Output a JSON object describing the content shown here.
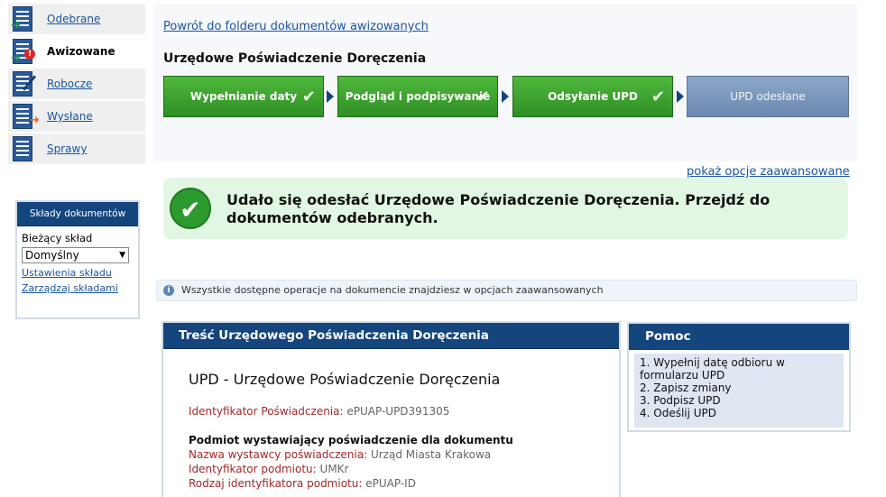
{
  "nav": {
    "items": [
      {
        "label": "Odebrane"
      },
      {
        "label": "Awizowane"
      },
      {
        "label": "Robocze"
      },
      {
        "label": "Wysłane"
      },
      {
        "label": "Sprawy"
      }
    ]
  },
  "sklady": {
    "title": "Składy dokumentów",
    "current_label": "Bieżący skład",
    "selected": "Domyślny",
    "settings_link": "Ustawienia składu",
    "manage_link": "Zarządzaj składami"
  },
  "main": {
    "back_link": "Powrót do folderu dokumentów awizowanych",
    "title": "Urzędowe Poświadczenie Doręczenia",
    "steps": [
      {
        "label": "Wypełnianie daty"
      },
      {
        "label": "Podgląd i podpisywanie"
      },
      {
        "label": "Odsyłanie UPD"
      },
      {
        "label": "UPD odesłane"
      }
    ],
    "advanced_link": "pokaż opcje zaawansowane",
    "success_message": "Udało się odesłać Urzędowe Poświadczenie Doręczenia. Przejdź do dokumentów odebranych.",
    "info_text": "Wszystkie dostępne operacje na dokumencie znajdziesz w opcjach zaawansowanych"
  },
  "panel": {
    "header": "Treść Urzędowego Poświadczenia Doręczenia",
    "doc_title": "UPD - Urzędowe Poświadczenie Doręczenia",
    "id_label": "Identyfikator Poświadczenia:",
    "id_value": "ePUAP-UPD391305",
    "section_title": "Podmiot wystawiający poświadczenie dla dokumentu",
    "fields": [
      {
        "label": "Nazwa wystawcy poświadczenia:",
        "value": "Urząd Miasta Krakowa"
      },
      {
        "label": "Identyfikator podmiotu:",
        "value": "UMKr"
      },
      {
        "label": "Rodzaj identyfikatora podmiotu:",
        "value": "ePUAP-ID"
      }
    ]
  },
  "help": {
    "header": "Pomoc",
    "steps": [
      "1. Wypełnij datę odbioru w formularzu UPD",
      "2. Zapisz zmiany",
      "3. Podpisz UPD",
      "4. Odeślij UPD"
    ]
  },
  "colors": {
    "header_blue": "#15457d",
    "step_green": "#2e8f24",
    "step_pending": "#7b96bc",
    "success_bg": "#e2f7e3",
    "link": "#1a55a0"
  }
}
